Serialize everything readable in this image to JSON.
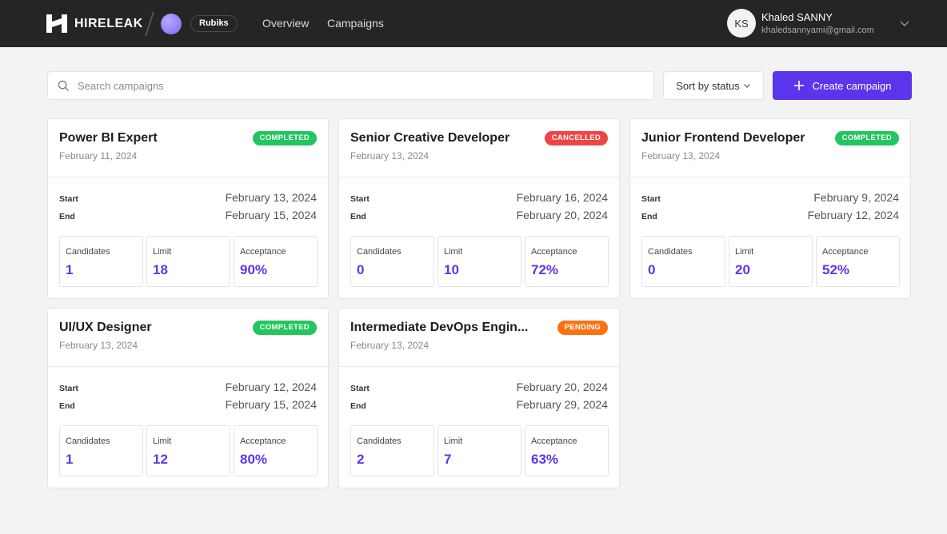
{
  "header": {
    "brand": "HIRELEAK",
    "org": "Rubiks",
    "nav": [
      "Overview",
      "Campaigns"
    ],
    "user": {
      "initials": "KS",
      "name": "Khaled SANNY",
      "email": "khaledsannyami@gmail.com"
    }
  },
  "toolbar": {
    "search_placeholder": "Search campaigns",
    "sort_label": "Sort by status",
    "create_label": "Create campaign"
  },
  "labels": {
    "start": "Start",
    "end": "End",
    "candidates": "Candidates",
    "limit": "Limit",
    "acceptance": "Acceptance"
  },
  "colors": {
    "accent": "#5b35ec",
    "completed": "#22c55e",
    "cancelled": "#ef4444",
    "pending": "#f97316"
  },
  "campaigns": [
    {
      "title": "Power BI Expert",
      "created": "February 11, 2024",
      "status": "COMPLETED",
      "start": "February 13, 2024",
      "end": "February 15, 2024",
      "candidates": "1",
      "limit": "18",
      "acceptance": "90%"
    },
    {
      "title": "Senior Creative Developer",
      "created": "February 13, 2024",
      "status": "CANCELLED",
      "start": "February 16, 2024",
      "end": "February 20, 2024",
      "candidates": "0",
      "limit": "10",
      "acceptance": "72%"
    },
    {
      "title": "Junior Frontend Developer",
      "created": "February 13, 2024",
      "status": "COMPLETED",
      "start": "February 9, 2024",
      "end": "February 12, 2024",
      "candidates": "0",
      "limit": "20",
      "acceptance": "52%"
    },
    {
      "title": "UI/UX Designer",
      "created": "February 13, 2024",
      "status": "COMPLETED",
      "start": "February 12, 2024",
      "end": "February 15, 2024",
      "candidates": "1",
      "limit": "12",
      "acceptance": "80%"
    },
    {
      "title": "Intermediate DevOps Engin...",
      "created": "February 13, 2024",
      "status": "PENDING",
      "start": "February 20, 2024",
      "end": "February 29, 2024",
      "candidates": "2",
      "limit": "7",
      "acceptance": "63%"
    }
  ]
}
